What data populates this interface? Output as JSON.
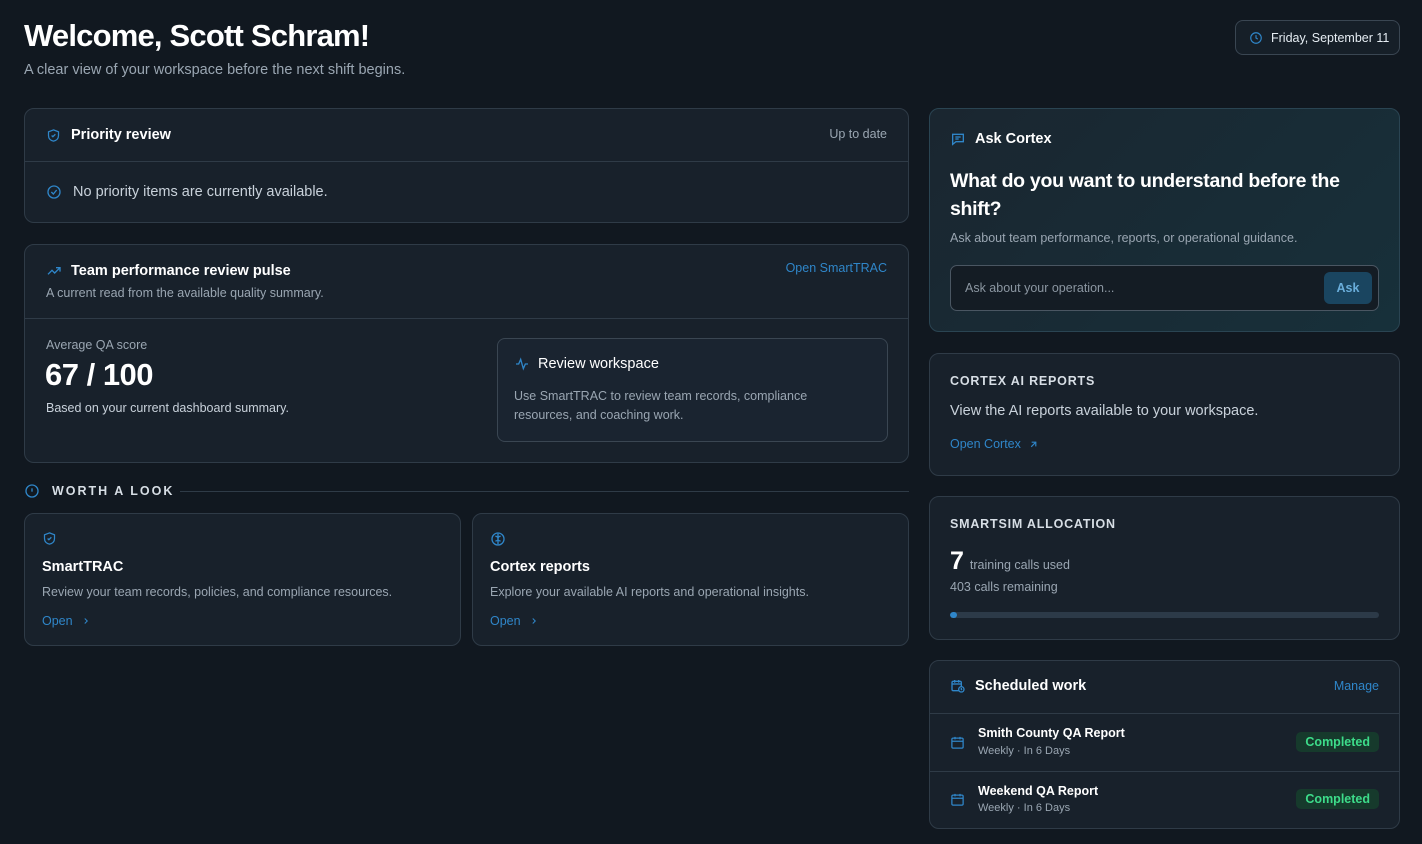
{
  "header": {
    "title": "Welcome, Scott Schram!",
    "subtitle": "A clear view of your workspace before the next shift begins.",
    "date": "Friday, September 11"
  },
  "priority": {
    "title": "Priority review",
    "status": "Up to date",
    "message": "No priority items are currently available."
  },
  "pulse": {
    "title": "Team performance review pulse",
    "subtitle": "A current read from the available quality summary.",
    "link": "Open SmartTRAC",
    "score_label": "Average QA score",
    "score_value": "67 / 100",
    "score_note": "Based on your current dashboard summary.",
    "workspace_title": "Review workspace",
    "workspace_desc": "Use SmartTRAC to review team records, compliance resources, and coaching work."
  },
  "worth": {
    "heading": "WORTH A LOOK",
    "cards": [
      {
        "title": "SmartTRAC",
        "desc": "Review your team records, policies, and compliance resources.",
        "link": "Open"
      },
      {
        "title": "Cortex reports",
        "desc": "Explore your available AI reports and operational insights.",
        "link": "Open"
      }
    ]
  },
  "ask": {
    "title": "Ask Cortex",
    "question": "What do you want to understand before the shift?",
    "hint": "Ask about team performance, reports, or operational guidance.",
    "placeholder": "Ask about your operation...",
    "button": "Ask"
  },
  "reports": {
    "heading": "CORTEX AI REPORTS",
    "desc": "View the AI reports available to your workspace.",
    "link": "Open Cortex"
  },
  "smartsim": {
    "heading": "SMARTSIM ALLOCATION",
    "used": "7",
    "used_label": "training calls used",
    "remaining": "403 calls remaining",
    "progress_fraction": 0.017
  },
  "scheduled": {
    "title": "Scheduled work",
    "manage": "Manage",
    "items": [
      {
        "name": "Smith County QA Report",
        "meta": "Weekly · In 6 Days",
        "status": "Completed"
      },
      {
        "name": "Weekend QA Report",
        "meta": "Weekly · In 6 Days",
        "status": "Completed"
      }
    ]
  },
  "colors": {
    "background": "#111820",
    "card": "#18212b",
    "accent": "#2f86c9",
    "success": "#3ddc8a"
  },
  "icons": [
    "clock-icon",
    "shield-icon",
    "check-circle-icon",
    "trend-up-icon",
    "activity-icon",
    "info-icon",
    "brain-icon",
    "chat-icon",
    "arrow-up-right-icon",
    "chevron-right-icon",
    "calendar-clock-icon",
    "calendar-icon"
  ]
}
